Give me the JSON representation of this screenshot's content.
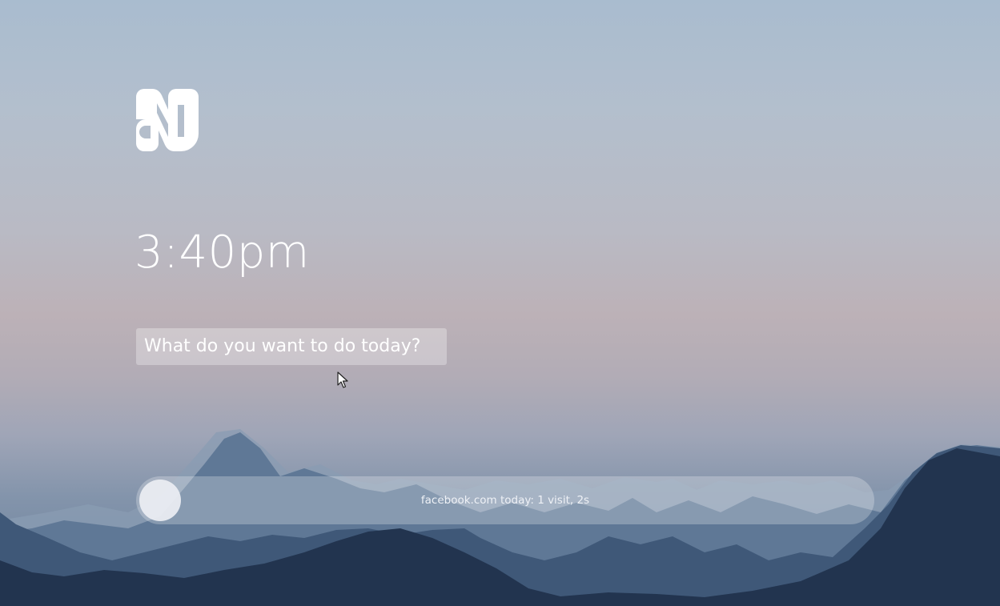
{
  "clock": {
    "time": "3:40pm"
  },
  "intent": {
    "placeholder": "What do you want to do today?"
  },
  "visit_tracker": {
    "summary": "facebook.com today: 1 visit, 2s"
  },
  "icons": {
    "logo": "app-logo-icon",
    "cursor": "mouse-pointer-icon"
  },
  "colors": {
    "text": "#ffffff",
    "sky_top": "#a9bccf",
    "mountain": "#2e4666"
  }
}
